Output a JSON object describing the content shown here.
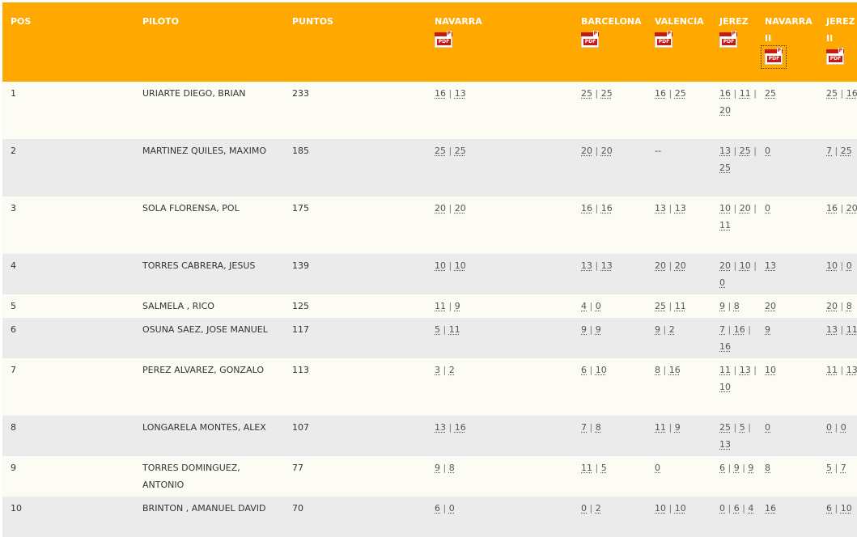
{
  "header": {
    "pos": "POS",
    "piloto": "PILOTO",
    "puntos": "PUNTOS",
    "races": [
      {
        "label": "NAVARRA",
        "pdf_icon": "pdf-icon"
      },
      {
        "label": "BARCELONA",
        "pdf_icon": "pdf-icon"
      },
      {
        "label": "VALENCIA",
        "pdf_icon": "pdf-icon"
      },
      {
        "label": "JEREZ",
        "pdf_icon": "pdf-icon"
      },
      {
        "label": "NAVARRA II",
        "pdf_icon": "pdf-icon"
      },
      {
        "label": "JEREZ II",
        "pdf_icon": "pdf-icon"
      }
    ],
    "pdf_label": "PDF",
    "pdf_p": "P"
  },
  "separator": "|",
  "no_result": "--",
  "colors": {
    "header_bg": "#ffa800",
    "row_odd": "#fcfcf5",
    "row_even": "#ebebeb",
    "pdf_red": "#c61a12"
  },
  "rows": [
    {
      "pos": "1",
      "piloto": "URIARTE DIEGO, BRIAN",
      "puntos": "233",
      "results": [
        [
          "16",
          "13"
        ],
        [
          "25",
          "25"
        ],
        [
          "16",
          "25"
        ],
        [
          "16",
          "11",
          "20"
        ],
        [
          "25"
        ],
        [
          "25",
          "16"
        ]
      ]
    },
    {
      "pos": "2",
      "piloto": "MARTINEZ QUILES, MAXIMO",
      "puntos": "185",
      "results": [
        [
          "25",
          "25"
        ],
        [
          "20",
          "20"
        ],
        [],
        [
          "13",
          "25",
          "25"
        ],
        [
          "0"
        ],
        [
          "7",
          "25"
        ]
      ]
    },
    {
      "pos": "3",
      "piloto": "SOLA FLORENSA, POL",
      "puntos": "175",
      "results": [
        [
          "20",
          "20"
        ],
        [
          "16",
          "16"
        ],
        [
          "13",
          "13"
        ],
        [
          "10",
          "20",
          "11"
        ],
        [
          "0"
        ],
        [
          "16",
          "20"
        ]
      ]
    },
    {
      "pos": "4",
      "piloto": "TORRES CABRERA, JESUS",
      "puntos": "139",
      "results": [
        [
          "10",
          "10"
        ],
        [
          "13",
          "13"
        ],
        [
          "20",
          "20"
        ],
        [
          "20",
          "10",
          "0"
        ],
        [
          "13"
        ],
        [
          "10",
          "0"
        ]
      ]
    },
    {
      "pos": "5",
      "piloto": "SALMELA , RICO",
      "puntos": "125",
      "results": [
        [
          "11",
          "9"
        ],
        [
          "4",
          "0"
        ],
        [
          "25",
          "11"
        ],
        [
          "9",
          "8"
        ],
        [
          "20"
        ],
        [
          "20",
          "8"
        ]
      ]
    },
    {
      "pos": "6",
      "piloto": "OSUNA SAEZ, JOSE MANUEL",
      "puntos": "117",
      "results": [
        [
          "5",
          "11"
        ],
        [
          "9",
          "9"
        ],
        [
          "9",
          "2"
        ],
        [
          "7",
          "16",
          "16"
        ],
        [
          "9"
        ],
        [
          "13",
          "11"
        ]
      ]
    },
    {
      "pos": "7",
      "piloto": "PEREZ ALVAREZ, GONZALO",
      "puntos": "113",
      "results": [
        [
          "3",
          "2"
        ],
        [
          "6",
          "10"
        ],
        [
          "8",
          "16"
        ],
        [
          "11",
          "13",
          "10"
        ],
        [
          "10"
        ],
        [
          "11",
          "13"
        ]
      ]
    },
    {
      "pos": "8",
      "piloto": "LONGARELA MONTES, ALEX",
      "puntos": "107",
      "results": [
        [
          "13",
          "16"
        ],
        [
          "7",
          "8"
        ],
        [
          "11",
          "9"
        ],
        [
          "25",
          "5",
          "13"
        ],
        [
          "0"
        ],
        [
          "0",
          "0"
        ]
      ]
    },
    {
      "pos": "9",
      "piloto": "TORRES DOMINGUEZ, ANTONIO",
      "puntos": "77",
      "results": [
        [
          "9",
          "8"
        ],
        [
          "11",
          "5"
        ],
        [
          "0"
        ],
        [
          "6",
          "9",
          "9"
        ],
        [
          "8"
        ],
        [
          "5",
          "7"
        ]
      ]
    },
    {
      "pos": "10",
      "piloto": "BRINTON , AMANUEL DAVID",
      "puntos": "70",
      "results": [
        [
          "6",
          "0"
        ],
        [
          "0",
          "2"
        ],
        [
          "10",
          "10"
        ],
        [
          "0",
          "6",
          "4"
        ],
        [
          "16"
        ],
        [
          "6",
          "10"
        ]
      ]
    }
  ]
}
